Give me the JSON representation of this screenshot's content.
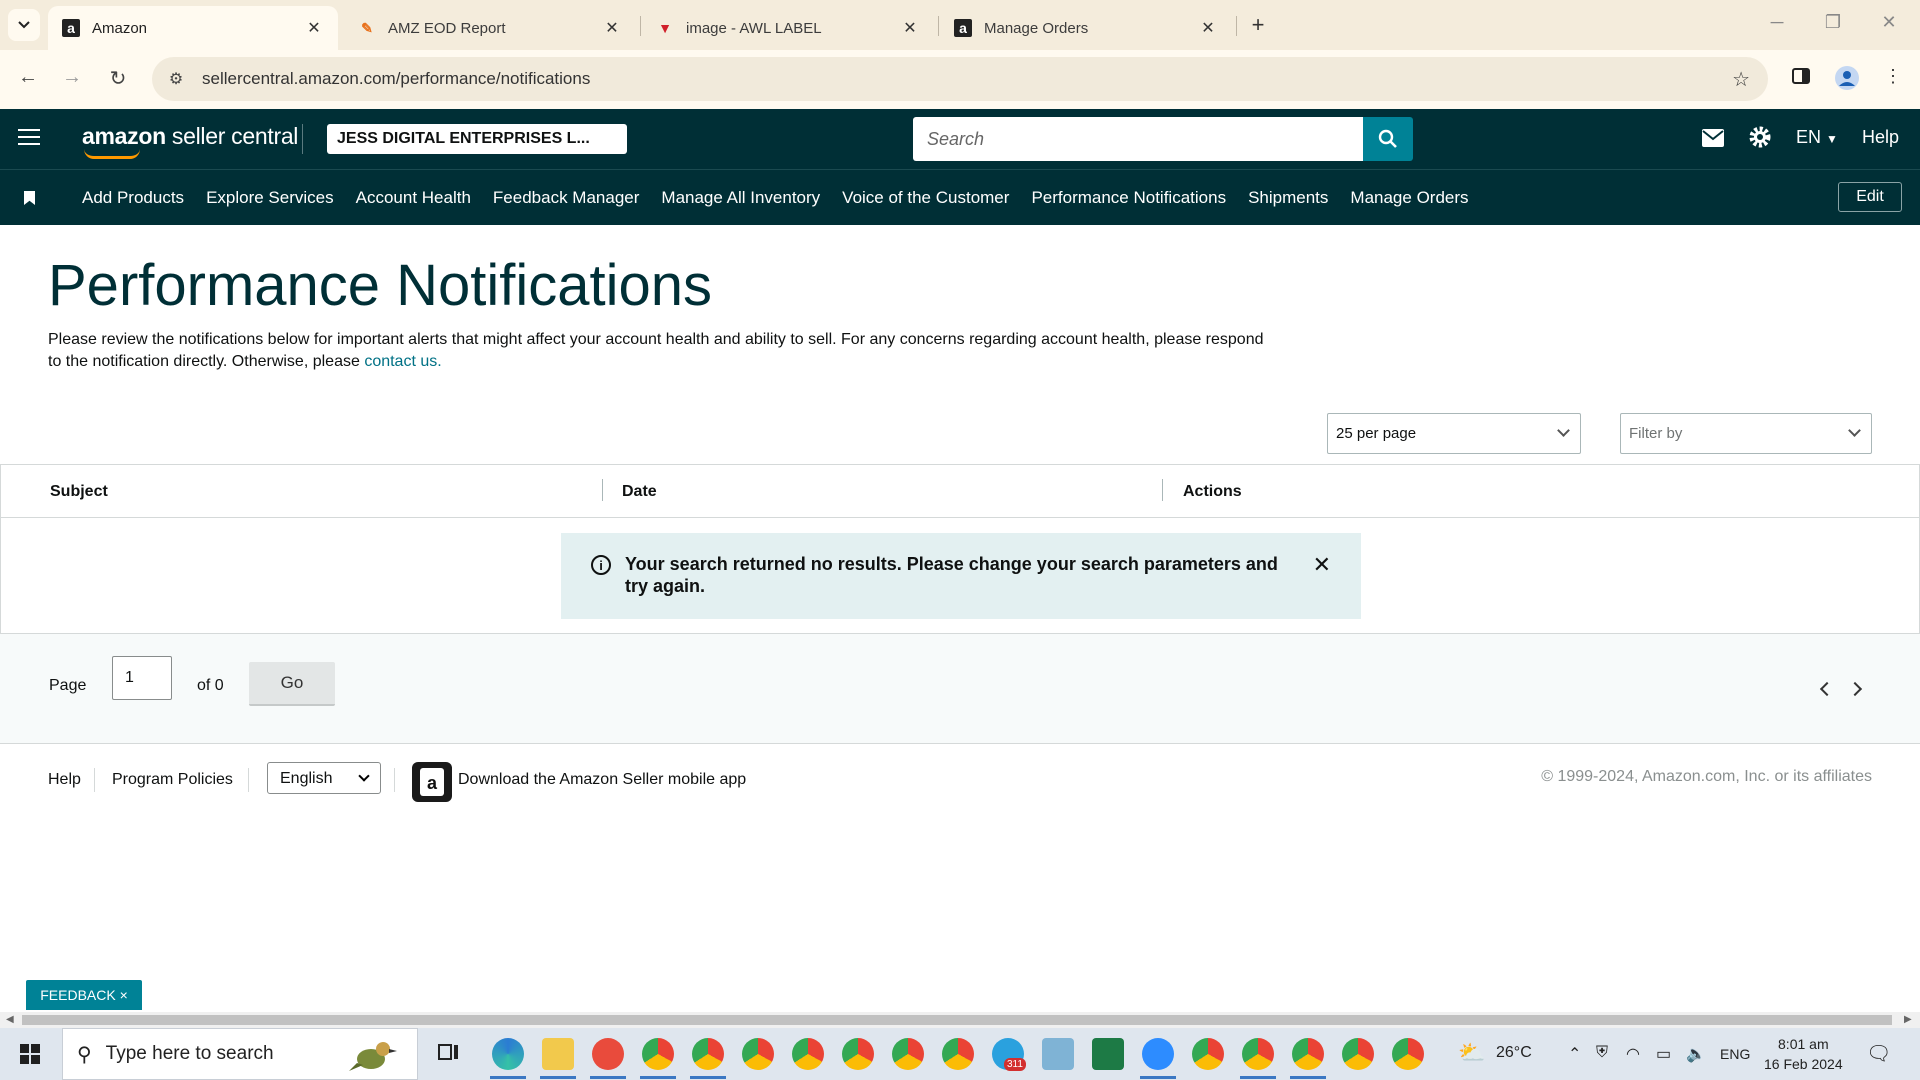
{
  "browser": {
    "tabs": [
      {
        "title": "Amazon",
        "favicon": "amazon-a-icon",
        "active": true
      },
      {
        "title": "AMZ EOD Report",
        "favicon": "pencil-app-icon",
        "active": false
      },
      {
        "title": "image - AWL LABEL",
        "favicon": "triangle-app-icon",
        "active": false
      },
      {
        "title": "Manage Orders",
        "favicon": "amazon-a-icon",
        "active": false
      }
    ],
    "url": "sellercentral.amazon.com/performance/notifications"
  },
  "header": {
    "logo_bold": "amazon",
    "logo_rest": " seller central",
    "store_name": "JESS DIGITAL ENTERPRISES L...",
    "search_placeholder": "Search",
    "language": "EN",
    "help": "Help"
  },
  "nav": {
    "links": [
      "Add Products",
      "Explore Services",
      "Account Health",
      "Feedback Manager",
      "Manage All Inventory",
      "Voice of the Customer",
      "Performance Notifications",
      "Shipments",
      "Manage Orders"
    ],
    "edit": "Edit"
  },
  "main": {
    "title": "Performance Notifications",
    "intro_text": "Please review the notifications below for important alerts that might affect your account health and ability to sell. For any concerns regarding account health, please respond to the notification directly. Otherwise, please ",
    "intro_link": "contact us.",
    "per_page": "25 per page",
    "filter_placeholder": "Filter by",
    "columns": [
      "Subject",
      "Date",
      "Actions"
    ],
    "alert": "Your search returned no results. Please change your search parameters and try again."
  },
  "pager": {
    "page_label": "Page",
    "page_value": "1",
    "of_label": "of 0",
    "go": "Go"
  },
  "footer": {
    "help": "Help",
    "policies": "Program Policies",
    "language": "English",
    "app_text": "Download the Amazon Seller mobile app",
    "copyright": "© 1999-2024, Amazon.com, Inc. or its affiliates"
  },
  "feedback": "FEEDBACK ×",
  "taskbar": {
    "search_placeholder": "Type here to search",
    "temperature": "26°C",
    "lang": "ENG",
    "time": "8:01 am",
    "date": "16 Feb 2024",
    "badge": "311"
  },
  "colors": {
    "header_bg": "#002f36",
    "accent_teal": "#008296",
    "link": "#007185"
  }
}
